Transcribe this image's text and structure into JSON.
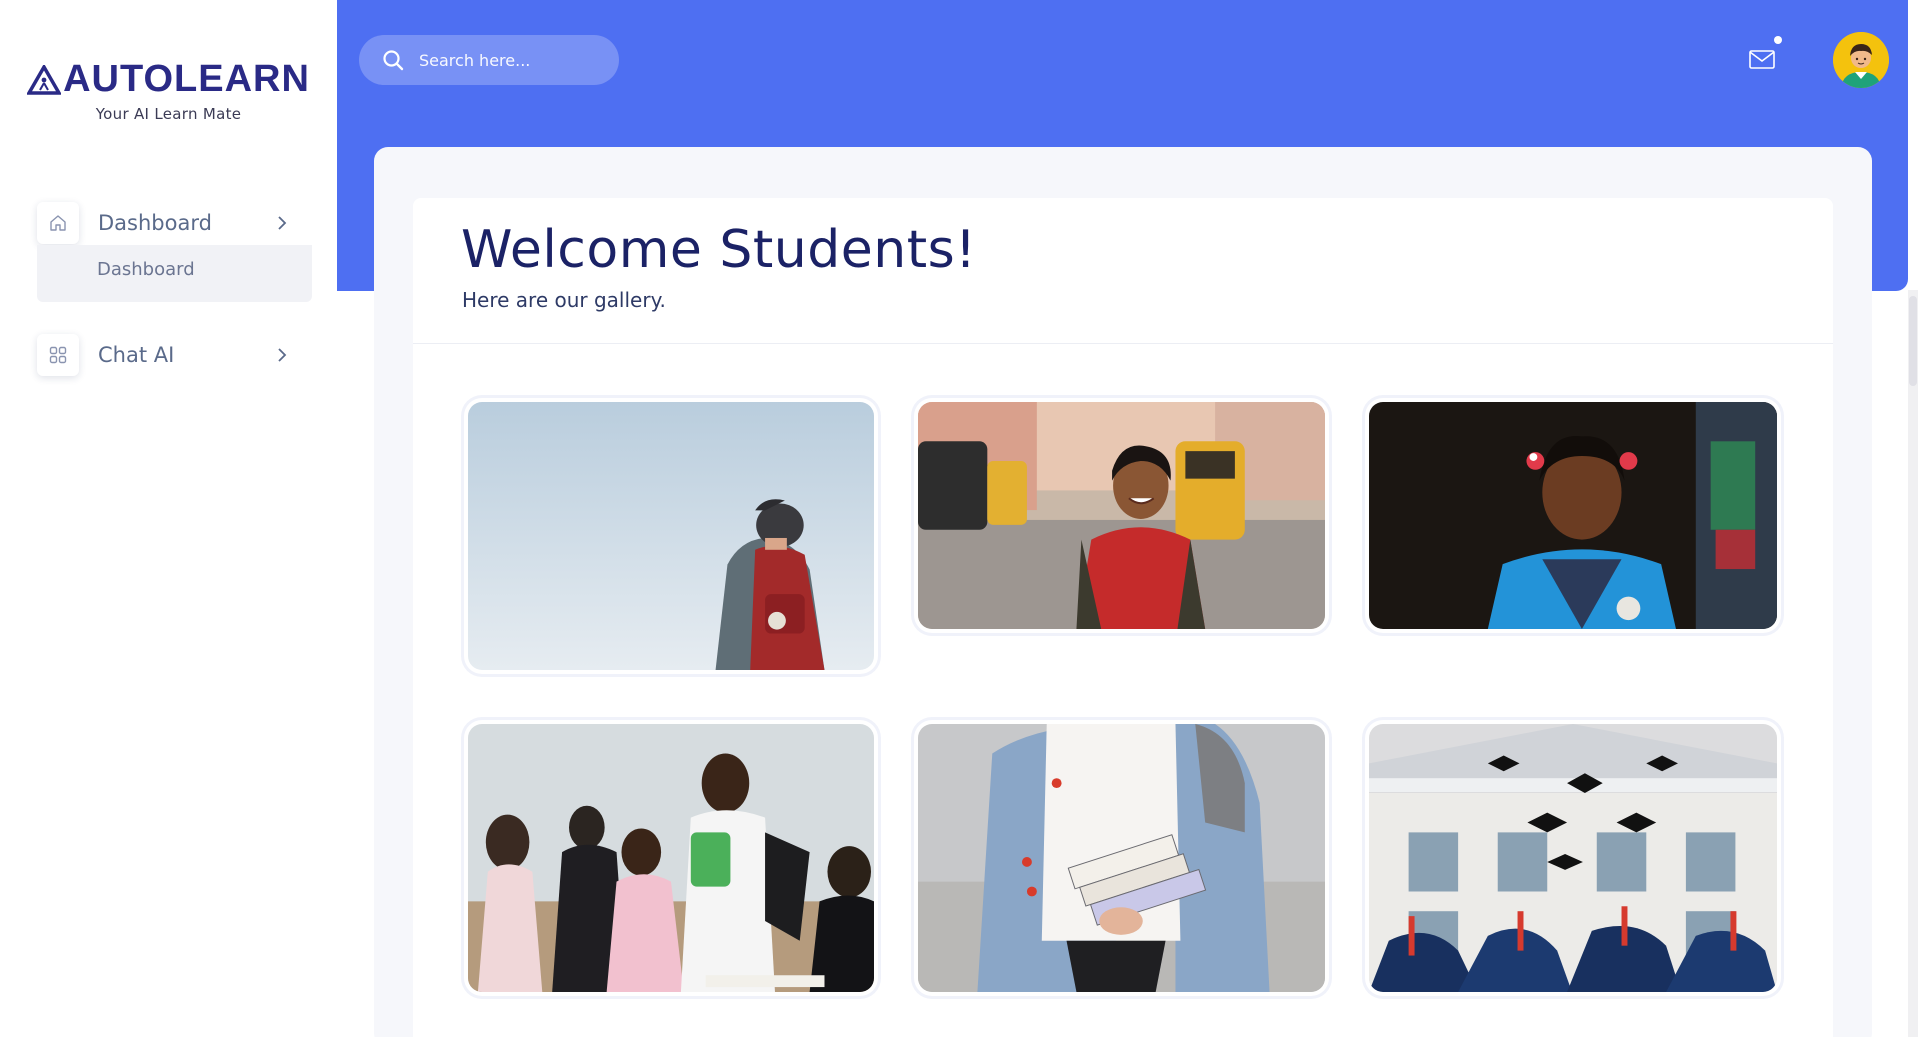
{
  "brand": {
    "name": "AUTOLEARN",
    "tagline": "Your AI Learn Mate"
  },
  "sidebar": {
    "items": [
      {
        "label": "Dashboard",
        "icon": "home-icon",
        "expanded": true,
        "children": [
          {
            "label": "Dashboard"
          }
        ]
      },
      {
        "label": "Chat AI",
        "icon": "grid-icon",
        "expanded": false
      }
    ]
  },
  "topbar": {
    "search_placeholder": "Search here...",
    "mail_icon": "mail-icon",
    "avatar_icon": "user-avatar"
  },
  "main": {
    "title": "Welcome Students!",
    "subtitle": "Here are our gallery."
  },
  "gallery": {
    "photos": [
      {
        "name": "student-with-red-backpack"
      },
      {
        "name": "smiling-girl-street"
      },
      {
        "name": "girl-school-uniform"
      },
      {
        "name": "classroom-students"
      },
      {
        "name": "student-holding-books"
      },
      {
        "name": "graduation-caps-toss"
      }
    ]
  },
  "colors": {
    "accent": "#4e6ff2",
    "brand": "#2a2a86",
    "title": "#1b2266",
    "background": "#f6f7fb"
  }
}
